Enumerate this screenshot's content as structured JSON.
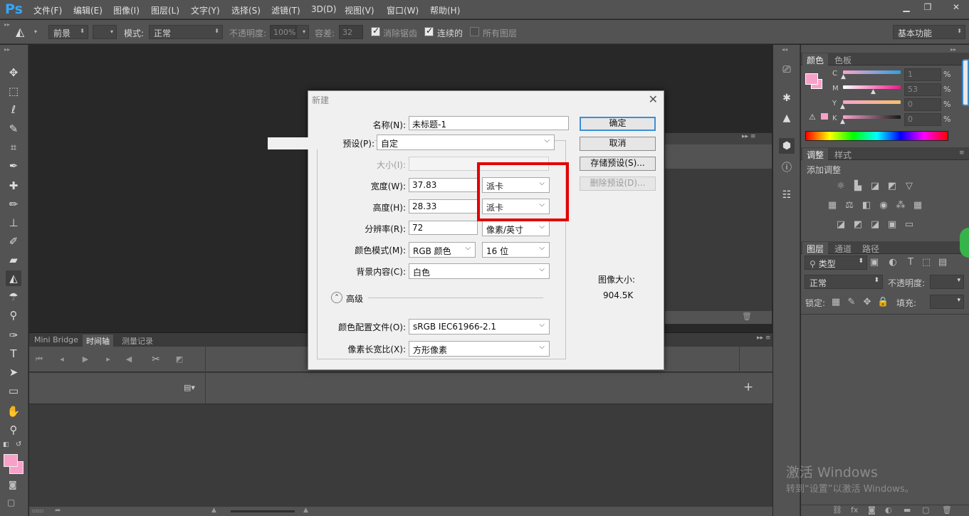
{
  "app": {
    "logo": "Ps",
    "menu": [
      "文件(F)",
      "编辑(E)",
      "图像(I)",
      "图层(L)",
      "文字(Y)",
      "选择(S)",
      "滤镜(T)",
      "3D(D)",
      "视图(V)",
      "窗口(W)",
      "帮助(H)"
    ],
    "window_controls": [
      "minimize-icon",
      "restore-icon",
      "close-icon"
    ]
  },
  "options_bar": {
    "fill_source": "前景",
    "mode_label": "模式:",
    "mode_value": "正常",
    "opacity_label": "不透明度:",
    "opacity_value": "100%",
    "tolerance_label": "容差:",
    "tolerance_value": "32",
    "antialias_label": "消除锯齿",
    "antialias_checked": true,
    "contiguous_label": "连续的",
    "contiguous_checked": true,
    "all_layers_label": "所有图层",
    "all_layers_checked": false,
    "workspace": "基本功能"
  },
  "tools": [
    "move-icon",
    "marquee-icon",
    "lasso-icon",
    "quick-select-icon",
    "crop-icon",
    "eyedropper-icon",
    "healing-brush-icon",
    "brush-icon",
    "clone-stamp-icon",
    "history-brush-icon",
    "eraser-icon",
    "paint-bucket-icon",
    "blur-icon",
    "dodge-icon",
    "pen-icon",
    "type-icon",
    "path-select-icon",
    "shape-icon",
    "hand-icon",
    "zoom-icon"
  ],
  "colors": {
    "foreground": "#f7a1c9",
    "background": "#f7a1c9",
    "accent_blue": "#31a8ff",
    "highlight_red": "#e20000"
  },
  "timeline_panel": {
    "tabs": [
      "Mini Bridge",
      "时间轴",
      "测量记录"
    ],
    "active_tab": 1,
    "add_label": "+"
  },
  "dialog": {
    "title": "新建",
    "name_label": "名称(N):",
    "name_value": "未标题-1",
    "preset_label": "预设(P):",
    "preset_value": "自定",
    "size_label": "大小(I):",
    "width_label": "宽度(W):",
    "width_value": "37.83",
    "width_unit": "派卡",
    "height_label": "高度(H):",
    "height_value": "28.33",
    "height_unit": "派卡",
    "resolution_label": "分辨率(R):",
    "resolution_value": "72",
    "resolution_unit": "像素/英寸",
    "color_mode_label": "颜色模式(M):",
    "color_mode_value": "RGB 颜色",
    "bit_depth_value": "16 位",
    "background_label": "背景内容(C):",
    "background_value": "白色",
    "advanced_label": "高级",
    "color_profile_label": "颜色配置文件(O):",
    "color_profile_value": "sRGB IEC61966-2.1",
    "pixel_aspect_label": "像素长宽比(X):",
    "pixel_aspect_value": "方形像素",
    "ok_button": "确定",
    "cancel_button": "取消",
    "save_preset_button": "存储预设(S)...",
    "delete_preset_button": "删除预设(D)...",
    "image_size_label": "图像大小:",
    "image_size_value": "904.5K"
  },
  "color_panel": {
    "tabs": [
      "颜色",
      "色板"
    ],
    "channels": [
      {
        "label": "C",
        "value": "1",
        "percent": 1
      },
      {
        "label": "M",
        "value": "53",
        "percent": 53
      },
      {
        "label": "Y",
        "value": "0",
        "percent": 0
      },
      {
        "label": "K",
        "value": "0",
        "percent": 0
      }
    ],
    "pct_sign": "%"
  },
  "adjustments_panel": {
    "tabs": [
      "调整",
      "样式"
    ],
    "add_label": "添加调整"
  },
  "layers_panel": {
    "tabs": [
      "图层",
      "通道",
      "路径"
    ],
    "filter_label": "类型",
    "blend_mode": "正常",
    "opacity_label": "不透明度:",
    "lock_label": "锁定:",
    "fill_label": "填充:"
  },
  "watermark": {
    "line1": "激活 Windows",
    "line2": "转到“设置”以激活 Windows。"
  }
}
